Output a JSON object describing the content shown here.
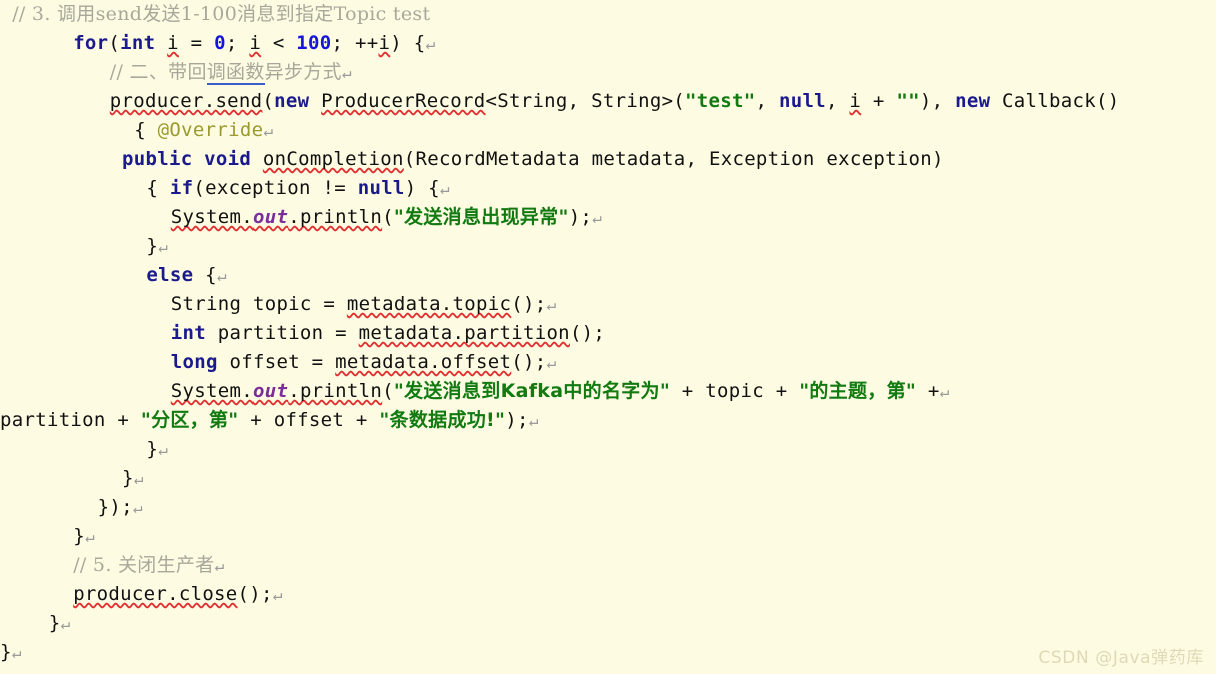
{
  "editor": {
    "background_color": "#fdfbe2",
    "default_text_color": "#111111",
    "language": "java",
    "colors": {
      "comment": "#a8a89a",
      "keyword": "#1a1a8c",
      "number": "#1515d8",
      "string": "#117a11",
      "annotation": "#9a9a2e",
      "static_field": "#7a2e9a",
      "pilcrow": "#9a9a9a",
      "spellcheck_squiggle": "#e03030",
      "grammar_underline": "#3a5fcd",
      "watermark": "#ded9b6"
    }
  },
  "watermark": {
    "text": "CSDN @Java弹药库"
  },
  "code": {
    "pilcrow": "↵",
    "lines": [
      {
        "indent": 1,
        "tokens": [
          {
            "style": "comment",
            "text": "// 3."
          },
          {
            "style": "cncomment",
            "text": " 调用send发送1-100消息到指定Topic test"
          }
        ]
      },
      {
        "indent": 6,
        "tokens": [
          {
            "style": "keyword",
            "text": "for"
          },
          {
            "style": "plain",
            "text": "("
          },
          {
            "style": "keyword",
            "text": "int"
          },
          {
            "style": "plain",
            "text": " "
          },
          {
            "style": "plain",
            "squiggle": "red",
            "text": "i"
          },
          {
            "style": "plain",
            "text": " = "
          },
          {
            "style": "number",
            "text": "0"
          },
          {
            "style": "plain",
            "text": "; "
          },
          {
            "style": "plain",
            "squiggle": "red",
            "text": "i"
          },
          {
            "style": "plain",
            "text": " < "
          },
          {
            "style": "number",
            "text": "100"
          },
          {
            "style": "plain",
            "text": "; ++"
          },
          {
            "style": "plain",
            "squiggle": "red",
            "text": "i"
          },
          {
            "style": "plain",
            "text": ") {"
          },
          {
            "style": "crlf",
            "text": "↵"
          }
        ]
      },
      {
        "indent": 9,
        "tokens": [
          {
            "style": "comment",
            "text": "// "
          },
          {
            "style": "cncomment",
            "text": "二、带回"
          },
          {
            "style": "cncomment",
            "squiggle": "blue",
            "text": "调函数"
          },
          {
            "style": "cncomment",
            "text": "异步方式"
          },
          {
            "style": "crlf",
            "text": "↵"
          }
        ]
      },
      {
        "indent": 9,
        "tokens": [
          {
            "style": "plain",
            "squiggle": "red",
            "text": "producer.send"
          },
          {
            "style": "plain",
            "text": "("
          },
          {
            "style": "keyword",
            "text": "new"
          },
          {
            "style": "plain",
            "text": " "
          },
          {
            "style": "plain",
            "squiggle": "red",
            "text": "ProducerRecord"
          },
          {
            "style": "plain",
            "text": "<String, String>("
          },
          {
            "style": "string",
            "text": "\"test\""
          },
          {
            "style": "plain",
            "text": ", "
          },
          {
            "style": "keyword",
            "text": "null"
          },
          {
            "style": "plain",
            "text": ", "
          },
          {
            "style": "plain",
            "squiggle": "red",
            "text": "i"
          },
          {
            "style": "plain",
            "text": " + "
          },
          {
            "style": "string",
            "text": "\"\""
          },
          {
            "style": "plain",
            "text": "), "
          },
          {
            "style": "keyword",
            "text": "new"
          },
          {
            "style": "plain",
            "text": " Callback()"
          }
        ]
      },
      {
        "indent": 11,
        "tokens": [
          {
            "style": "plain",
            "text": "{ "
          },
          {
            "style": "annot",
            "text": "@Override"
          },
          {
            "style": "crlf",
            "text": "↵"
          }
        ]
      },
      {
        "indent": 10,
        "tokens": [
          {
            "style": "keyword",
            "text": "public void"
          },
          {
            "style": "plain",
            "text": " "
          },
          {
            "style": "plain",
            "squiggle": "red",
            "text": "onCompletion"
          },
          {
            "style": "plain",
            "text": "(RecordMetadata metadata, Exception exception)"
          }
        ]
      },
      {
        "indent": 12,
        "tokens": [
          {
            "style": "plain",
            "text": "{ "
          },
          {
            "style": "keyword",
            "text": "if"
          },
          {
            "style": "plain",
            "text": "(exception != "
          },
          {
            "style": "keyword",
            "text": "null"
          },
          {
            "style": "plain",
            "text": ") {"
          },
          {
            "style": "crlf",
            "text": "↵"
          }
        ]
      },
      {
        "indent": 14,
        "tokens": [
          {
            "style": "plain",
            "squiggle": "red",
            "text": "System."
          },
          {
            "style": "static",
            "squiggle": "red",
            "text": "out"
          },
          {
            "style": "plain",
            "squiggle": "red",
            "text": ".println"
          },
          {
            "style": "plain",
            "text": "("
          },
          {
            "style": "cnstr",
            "text": "\"发送消息出现异常\""
          },
          {
            "style": "plain",
            "text": ");"
          },
          {
            "style": "crlf",
            "text": "↵"
          }
        ]
      },
      {
        "indent": 12,
        "tokens": [
          {
            "style": "plain",
            "text": "}"
          },
          {
            "style": "crlf",
            "text": "↵"
          }
        ]
      },
      {
        "indent": 12,
        "tokens": [
          {
            "style": "keyword",
            "text": "else"
          },
          {
            "style": "plain",
            "text": " {"
          },
          {
            "style": "crlf",
            "text": "↵"
          }
        ]
      },
      {
        "indent": 14,
        "tokens": [
          {
            "style": "plain",
            "text": "String topic = "
          },
          {
            "style": "plain",
            "squiggle": "red",
            "text": "metadata.topic"
          },
          {
            "style": "plain",
            "text": "();"
          },
          {
            "style": "crlf",
            "text": "↵"
          }
        ]
      },
      {
        "indent": 14,
        "tokens": [
          {
            "style": "keyword",
            "text": "int"
          },
          {
            "style": "plain",
            "text": " partition = "
          },
          {
            "style": "plain",
            "squiggle": "red",
            "text": "metadata.partition"
          },
          {
            "style": "plain",
            "text": "();"
          }
        ]
      },
      {
        "indent": 14,
        "tokens": [
          {
            "style": "keyword",
            "text": "long"
          },
          {
            "style": "plain",
            "text": " offset = "
          },
          {
            "style": "plain",
            "squiggle": "red",
            "text": "metadata.offset"
          },
          {
            "style": "plain",
            "text": "();"
          },
          {
            "style": "crlf",
            "text": "↵"
          }
        ]
      },
      {
        "indent": 14,
        "tokens": [
          {
            "style": "plain",
            "squiggle": "red",
            "text": "System."
          },
          {
            "style": "static",
            "squiggle": "red",
            "text": "out"
          },
          {
            "style": "plain",
            "squiggle": "red",
            "text": ".println"
          },
          {
            "style": "plain",
            "text": "("
          },
          {
            "style": "cnstr",
            "text": "\"发送消息到Kafka中的名字为\""
          },
          {
            "style": "plain",
            "text": " + topic + "
          },
          {
            "style": "cnstr",
            "text": "\"的主题，第\""
          },
          {
            "style": "plain",
            "text": " +"
          },
          {
            "style": "crlf",
            "text": "↵"
          }
        ]
      },
      {
        "indent": 0,
        "tokens": [
          {
            "style": "plain",
            "text": "partition + "
          },
          {
            "style": "cnstr",
            "text": "\"分区，第\""
          },
          {
            "style": "plain",
            "text": " + offset + "
          },
          {
            "style": "cnstr",
            "text": "\"条数据成功!\""
          },
          {
            "style": "plain",
            "text": ");"
          },
          {
            "style": "crlf",
            "text": "↵"
          }
        ]
      },
      {
        "indent": 12,
        "tokens": [
          {
            "style": "plain",
            "text": "}"
          },
          {
            "style": "crlf",
            "text": "↵"
          }
        ]
      },
      {
        "indent": 10,
        "tokens": [
          {
            "style": "plain",
            "text": "}"
          },
          {
            "style": "crlf",
            "text": "↵"
          }
        ]
      },
      {
        "indent": 8,
        "tokens": [
          {
            "style": "plain",
            "text": "});"
          },
          {
            "style": "crlf",
            "text": "↵"
          }
        ]
      },
      {
        "indent": 6,
        "tokens": [
          {
            "style": "plain",
            "text": "}"
          },
          {
            "style": "crlf",
            "text": "↵"
          }
        ]
      },
      {
        "indent": 6,
        "tokens": [
          {
            "style": "comment",
            "text": "// 5."
          },
          {
            "style": "cncomment",
            "text": " 关闭生产者"
          },
          {
            "style": "crlf",
            "text": "↵"
          }
        ]
      },
      {
        "indent": 6,
        "tokens": [
          {
            "style": "plain",
            "squiggle": "red",
            "text": "producer.close"
          },
          {
            "style": "plain",
            "text": "();"
          },
          {
            "style": "crlf",
            "text": "↵"
          }
        ]
      },
      {
        "indent": 4,
        "tokens": [
          {
            "style": "plain",
            "text": "}"
          },
          {
            "style": "crlf",
            "text": "↵"
          }
        ]
      },
      {
        "indent": 0,
        "tokens": [
          {
            "style": "plain",
            "text": "}"
          },
          {
            "style": "crlf",
            "text": "↵"
          }
        ]
      }
    ]
  }
}
